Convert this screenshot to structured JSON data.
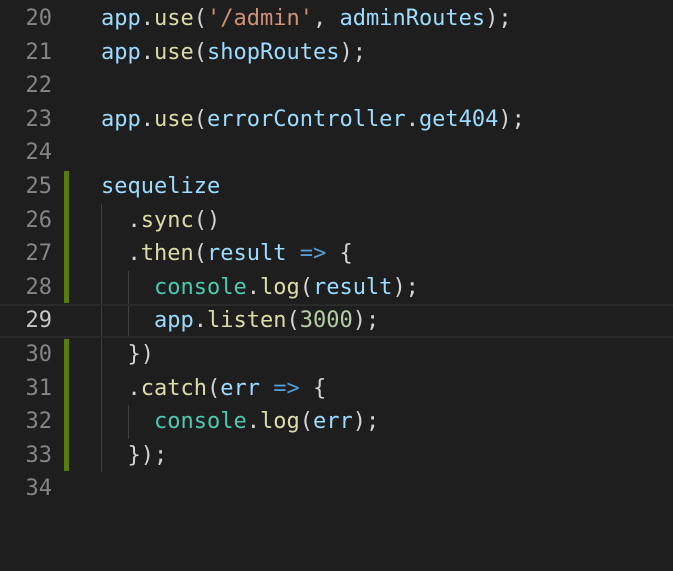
{
  "editor": {
    "active_line": "29",
    "lines": [
      {
        "number": "20",
        "tokens": [
          {
            "text": "app",
            "kind": "var"
          },
          {
            "text": ".",
            "kind": "punc"
          },
          {
            "text": "use",
            "kind": "fn"
          },
          {
            "text": "(",
            "kind": "punc"
          },
          {
            "text": "'/admin'",
            "kind": "str"
          },
          {
            "text": ", ",
            "kind": "punc"
          },
          {
            "text": "adminRoutes",
            "kind": "var"
          },
          {
            "text": ");",
            "kind": "punc"
          }
        ]
      },
      {
        "number": "21",
        "tokens": [
          {
            "text": "app",
            "kind": "var"
          },
          {
            "text": ".",
            "kind": "punc"
          },
          {
            "text": "use",
            "kind": "fn"
          },
          {
            "text": "(",
            "kind": "punc"
          },
          {
            "text": "shopRoutes",
            "kind": "var"
          },
          {
            "text": ");",
            "kind": "punc"
          }
        ]
      },
      {
        "number": "22",
        "tokens": []
      },
      {
        "number": "23",
        "tokens": [
          {
            "text": "app",
            "kind": "var"
          },
          {
            "text": ".",
            "kind": "punc"
          },
          {
            "text": "use",
            "kind": "fn"
          },
          {
            "text": "(",
            "kind": "punc"
          },
          {
            "text": "errorController",
            "kind": "var"
          },
          {
            "text": ".",
            "kind": "punc"
          },
          {
            "text": "get404",
            "kind": "var"
          },
          {
            "text": ");",
            "kind": "punc"
          }
        ]
      },
      {
        "number": "24",
        "tokens": []
      },
      {
        "number": "25",
        "tokens": [
          {
            "text": "sequelize",
            "kind": "var"
          }
        ]
      },
      {
        "number": "26",
        "tokens": [
          {
            "text": "  ",
            "kind": "punc"
          },
          {
            "text": ".",
            "kind": "punc"
          },
          {
            "text": "sync",
            "kind": "fn"
          },
          {
            "text": "()",
            "kind": "punc"
          }
        ]
      },
      {
        "number": "27",
        "tokens": [
          {
            "text": "  ",
            "kind": "punc"
          },
          {
            "text": ".",
            "kind": "punc"
          },
          {
            "text": "then",
            "kind": "fn"
          },
          {
            "text": "(",
            "kind": "punc"
          },
          {
            "text": "result",
            "kind": "var"
          },
          {
            "text": " ",
            "kind": "punc"
          },
          {
            "text": "=>",
            "kind": "op"
          },
          {
            "text": " {",
            "kind": "punc"
          }
        ]
      },
      {
        "number": "28",
        "tokens": [
          {
            "text": "    ",
            "kind": "punc"
          },
          {
            "text": "console",
            "kind": "cls"
          },
          {
            "text": ".",
            "kind": "punc"
          },
          {
            "text": "log",
            "kind": "fn"
          },
          {
            "text": "(",
            "kind": "punc"
          },
          {
            "text": "result",
            "kind": "var"
          },
          {
            "text": ");",
            "kind": "punc"
          }
        ]
      },
      {
        "number": "29",
        "tokens": [
          {
            "text": "    ",
            "kind": "punc"
          },
          {
            "text": "app",
            "kind": "var"
          },
          {
            "text": ".",
            "kind": "punc"
          },
          {
            "text": "listen",
            "kind": "fn"
          },
          {
            "text": "(",
            "kind": "punc"
          },
          {
            "text": "3000",
            "kind": "num"
          },
          {
            "text": ");",
            "kind": "punc"
          }
        ]
      },
      {
        "number": "30",
        "tokens": [
          {
            "text": "  ",
            "kind": "punc"
          },
          {
            "text": "})",
            "kind": "punc"
          }
        ]
      },
      {
        "number": "31",
        "tokens": [
          {
            "text": "  ",
            "kind": "punc"
          },
          {
            "text": ".",
            "kind": "punc"
          },
          {
            "text": "catch",
            "kind": "fn"
          },
          {
            "text": "(",
            "kind": "punc"
          },
          {
            "text": "err",
            "kind": "var"
          },
          {
            "text": " ",
            "kind": "punc"
          },
          {
            "text": "=>",
            "kind": "op"
          },
          {
            "text": " {",
            "kind": "punc"
          }
        ]
      },
      {
        "number": "32",
        "tokens": [
          {
            "text": "    ",
            "kind": "punc"
          },
          {
            "text": "console",
            "kind": "cls"
          },
          {
            "text": ".",
            "kind": "punc"
          },
          {
            "text": "log",
            "kind": "fn"
          },
          {
            "text": "(",
            "kind": "punc"
          },
          {
            "text": "err",
            "kind": "var"
          },
          {
            "text": ");",
            "kind": "punc"
          }
        ]
      },
      {
        "number": "33",
        "tokens": [
          {
            "text": "  ",
            "kind": "punc"
          },
          {
            "text": "});",
            "kind": "punc"
          }
        ]
      },
      {
        "number": "34",
        "tokens": []
      }
    ],
    "modified_line_groups": [
      [
        "25",
        "26",
        "27",
        "28"
      ],
      [
        "30",
        "31",
        "32",
        "33"
      ]
    ],
    "colors": {
      "background": "#1e1e1e",
      "line_number": "#858585",
      "line_number_active": "#c6c6c6",
      "gutter_modified": "#587c0c",
      "var": "#9cdcfe",
      "fn": "#dcdcaa",
      "str": "#ce9178",
      "num": "#b5cea8",
      "op": "#569cd6",
      "cls": "#4ec9b0",
      "punc": "#d4d4d4"
    }
  }
}
